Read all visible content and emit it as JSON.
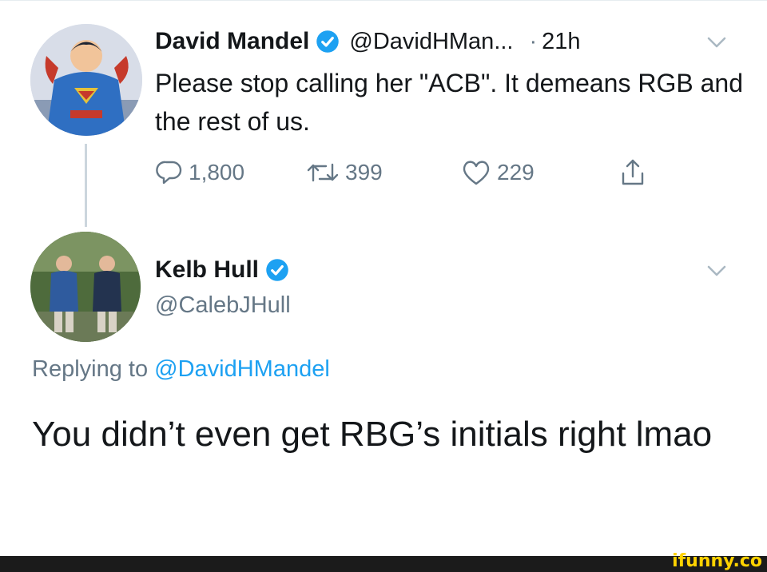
{
  "tweet1": {
    "name": "David Mandel",
    "handle": "@DavidHMan...",
    "separator": "·",
    "time": "21h",
    "text": "Please stop calling her \"ACB\". It demeans RGB and the rest of us.",
    "reply_count": "1,800",
    "retweet_count": "399",
    "like_count": "229"
  },
  "tweet2": {
    "name": "Kelb Hull",
    "handle": "@CalebJHull",
    "replying_prefix": "Replying to",
    "replying_mention": "@DavidHMandel",
    "text": "You didn’t even get RBG’s initials right lmao"
  },
  "watermark": "ifunny.co",
  "icons": {
    "verified": "verified-badge-icon",
    "reply": "reply-icon",
    "retweet": "retweet-icon",
    "like": "heart-icon",
    "share": "share-icon",
    "more": "chevron-down-icon"
  },
  "colors": {
    "accent": "#1da1f2",
    "muted": "#657786",
    "text": "#14171a",
    "watermark": "#ffd200"
  }
}
